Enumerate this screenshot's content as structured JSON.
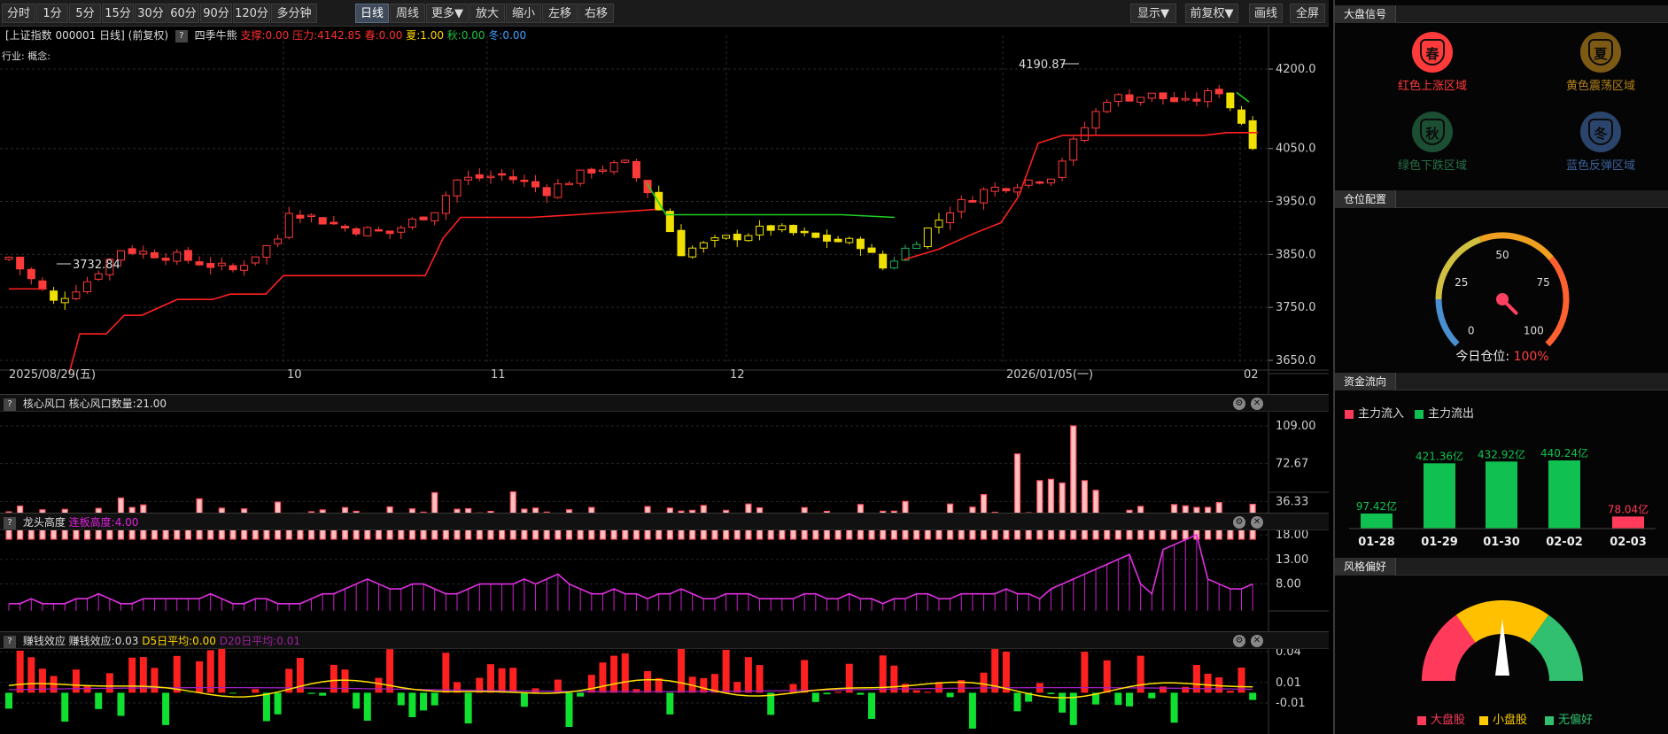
{
  "toolbar": {
    "left": [
      "分时",
      "1分",
      "5分",
      "15分",
      "30分",
      "60分",
      "90分",
      "120分",
      "多分钟",
      "日线",
      "周线",
      "更多▼",
      "放大",
      "缩小",
      "左移",
      "右移"
    ],
    "right": [
      "显示▼",
      "前复权▼",
      "画线",
      "全屏"
    ]
  },
  "info": {
    "name": "[上证指数 000001 日线]",
    "adjust": "(前复权)",
    "indicator": "四季牛熊",
    "support": "支撑:0.00",
    "pressure": "压力:4142.85",
    "spring": "春:0.00",
    "summer": "夏:1.00",
    "autumn": "秋:0.00",
    "winter": "冬:0.00",
    "industry": "行业:",
    "concept": "概念:"
  },
  "main": {
    "high_label": "4190.87",
    "low_label": "3732.84",
    "price_ticks": [
      "4200.0",
      "4050.0",
      "3950.0",
      "3850.0",
      "3750.0",
      "3650.0"
    ],
    "date_labels": [
      "2025/08/29(五)",
      "10",
      "11",
      "12",
      "2026/01/05(一)",
      "02"
    ]
  },
  "panel1": {
    "title": "核心风口",
    "value": "核心风口数量:21.00",
    "ticks": [
      "109.00",
      "72.67",
      "36.33"
    ]
  },
  "panel2": {
    "title": "龙头高度",
    "value": "连板高度:4.00",
    "ticks": [
      "18.00",
      "13.00",
      "8.00"
    ]
  },
  "panel3": {
    "title": "赚钱效应",
    "value": "赚钱效应:0.03",
    "d5": "D5日平均:0.00",
    "d20": "D20日平均:0.01",
    "ticks": [
      "0.04",
      "0.01",
      "-0.01"
    ]
  },
  "right": {
    "sec1": "大盘信号",
    "seasons": [
      {
        "glyph": "春",
        "label": "红色上涨区域",
        "color": "#ff3a3a"
      },
      {
        "glyph": "夏",
        "label": "黄色震荡区域",
        "color": "#e0a020"
      },
      {
        "glyph": "秋",
        "label": "绿色下跌区域",
        "color": "#2e8b57"
      },
      {
        "glyph": "冬",
        "label": "蓝色反弹区域",
        "color": "#4a78c0"
      }
    ],
    "sec2": "仓位配置",
    "gauge": {
      "ticks": [
        "0",
        "25",
        "50",
        "75",
        "100"
      ],
      "label": "今日仓位:",
      "value": "100%",
      "level": 100
    },
    "sec3": "资金流向",
    "flow_legend": [
      "主力流入",
      "主力流出"
    ],
    "flow": [
      {
        "date": "01-28",
        "value": "97.42亿",
        "amount": 97.42,
        "dir": "out"
      },
      {
        "date": "01-29",
        "value": "421.36亿",
        "amount": 421.36,
        "dir": "out"
      },
      {
        "date": "01-30",
        "value": "432.92亿",
        "amount": 432.92,
        "dir": "out"
      },
      {
        "date": "02-02",
        "value": "440.24亿",
        "amount": 440.24,
        "dir": "out"
      },
      {
        "date": "02-03",
        "value": "78.04亿",
        "amount": 78.04,
        "dir": "in"
      }
    ],
    "sec4": "风格偏好",
    "style_legend": [
      "大盘股",
      "小盘股",
      "无偏好"
    ]
  }
}
